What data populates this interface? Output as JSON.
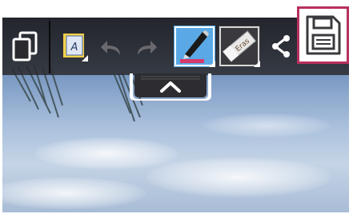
{
  "toolbar": {
    "buttons": [
      {
        "name": "multitask-icon",
        "enabled": true
      },
      {
        "name": "text-style-icon",
        "glyph": "A",
        "enabled": true
      },
      {
        "name": "undo-icon",
        "enabled": false
      },
      {
        "name": "redo-icon",
        "enabled": false
      },
      {
        "name": "pen-icon",
        "selected": true
      },
      {
        "name": "eraser-icon",
        "label": "Eras",
        "selected": false
      },
      {
        "name": "share-icon",
        "enabled": true
      },
      {
        "name": "save-icon",
        "highlighted": true
      }
    ]
  },
  "colors": {
    "toolbar_bg": "#2a2a2e",
    "highlight": "#b7305e",
    "pen_tile": "#5aa9e6",
    "pen_color": "#d63a6a",
    "sky": "#7a99c2"
  }
}
